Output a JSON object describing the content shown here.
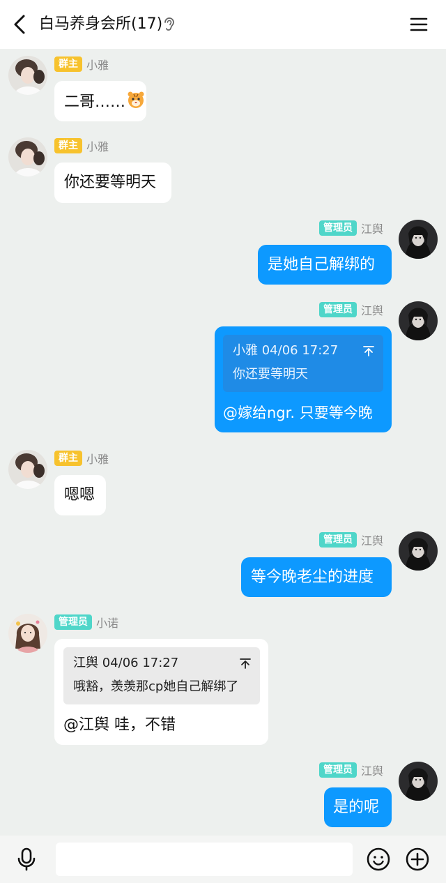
{
  "header": {
    "title": "白马养身会所(17)"
  },
  "badges": {
    "owner": "群主",
    "admin": "管理员"
  },
  "messages": [
    {
      "sender": "小雅",
      "role": "owner",
      "text": "二哥……",
      "emoji": "tiger-face-emoji"
    },
    {
      "sender": "小雅",
      "role": "owner",
      "text": "你还要等明天"
    },
    {
      "sender": "江舆",
      "role": "admin",
      "text": "是她自己解绑的"
    },
    {
      "sender": "江舆",
      "role": "admin",
      "quote_head": "小雅 04/06 17:27",
      "quote_body": "你还要等明天",
      "text": "@嫁给ngr. 只要等今晚"
    },
    {
      "sender": "小雅",
      "role": "owner",
      "text": "嗯嗯"
    },
    {
      "sender": "江舆",
      "role": "admin",
      "text": "等今晚老尘的进度"
    },
    {
      "sender": "小诺",
      "role": "admin",
      "quote_head": "江舆 04/06 17:27",
      "quote_body": "哦豁，羡羡那cp她自己解绑了",
      "text": "@江舆 哇，不错"
    },
    {
      "sender": "江舆",
      "role": "admin",
      "text": "是的呢"
    }
  ],
  "colors": {
    "outgoing_bubble": "#0d99ff",
    "incoming_bubble": "#ffffff",
    "owner_badge": "#f7c22d",
    "admin_badge": "#4fd6c9",
    "background": "#edf0ee"
  },
  "icons": [
    "back-arrow-icon",
    "ear-icon",
    "menu-icon",
    "quote-jump-icon",
    "microphone-icon",
    "smile-icon",
    "plus-icon"
  ]
}
